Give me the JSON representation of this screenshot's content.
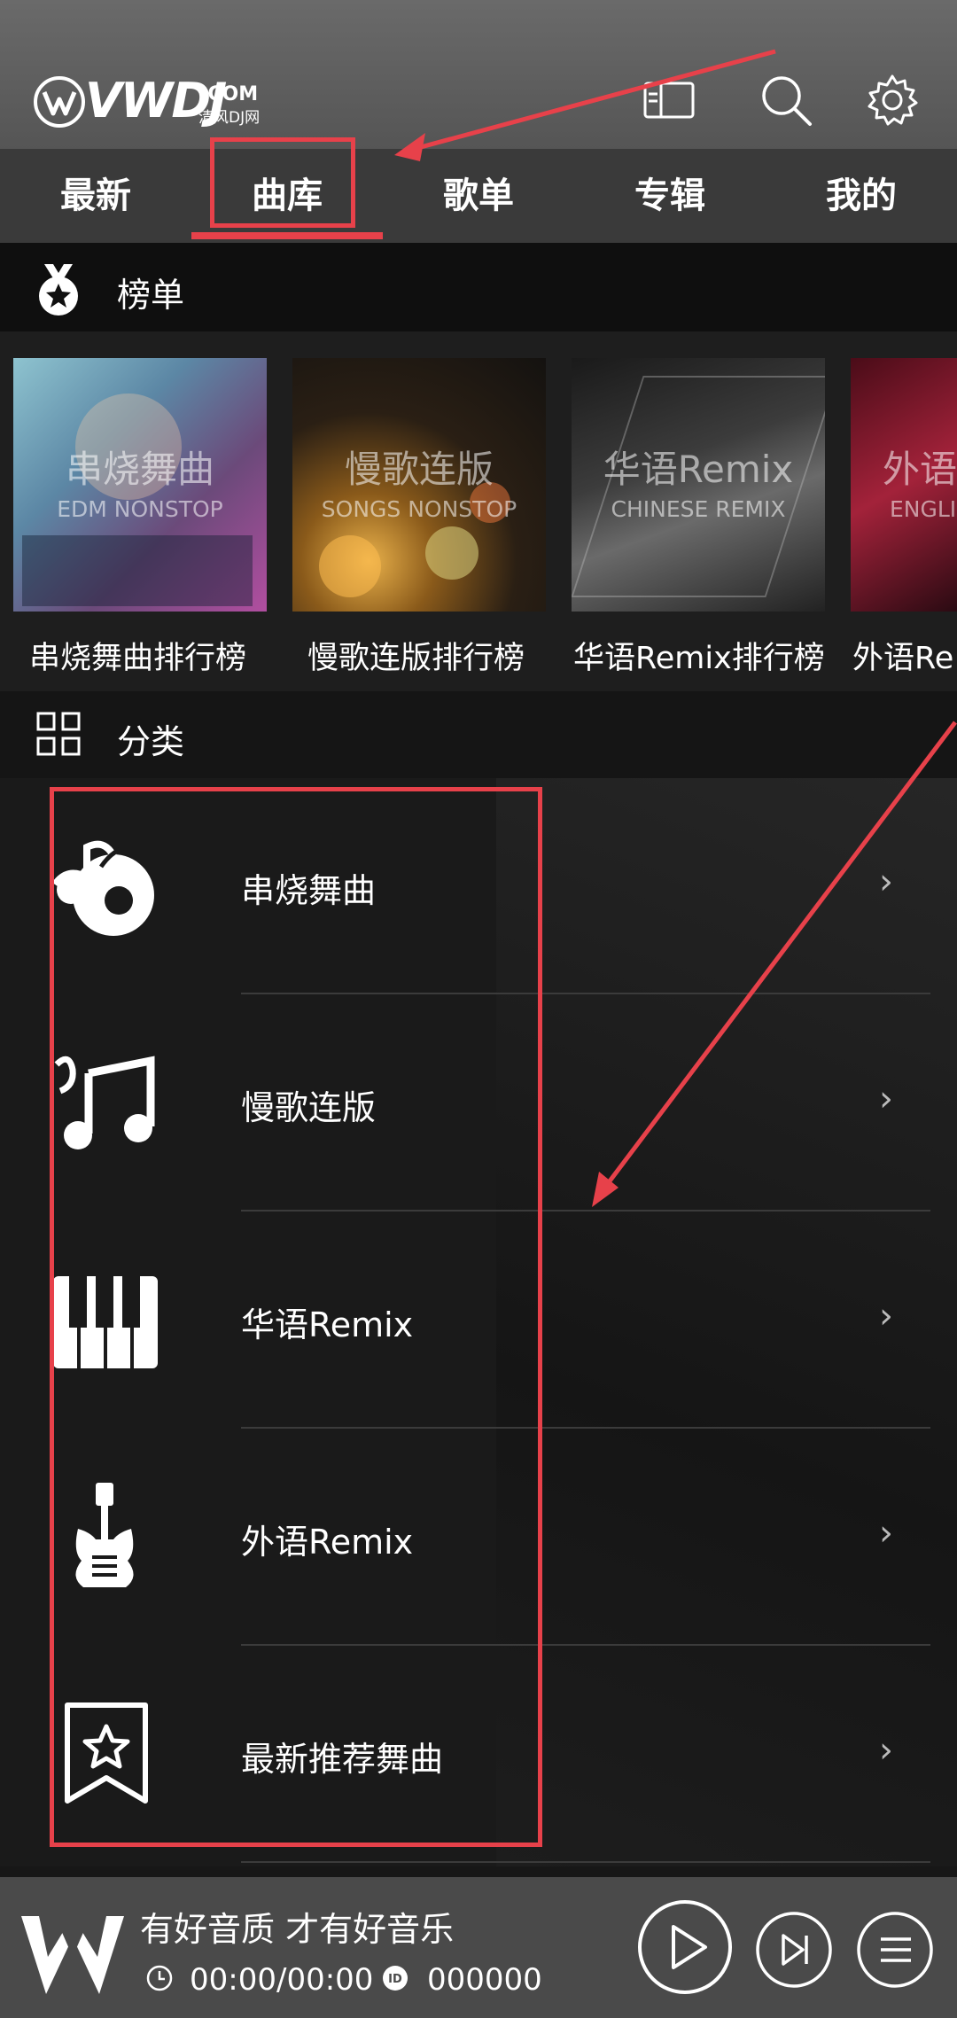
{
  "brand": {
    "logo_text": "VWDJ",
    "logo_com": ".COM",
    "logo_sub": "清风DJ网"
  },
  "header_icons": [
    "sidebar-toggle-icon",
    "search-icon",
    "gear-icon"
  ],
  "tabs": [
    {
      "label": "最新"
    },
    {
      "label": "曲库"
    },
    {
      "label": "歌单"
    },
    {
      "label": "专辑"
    },
    {
      "label": "我的"
    }
  ],
  "active_tab": "曲库",
  "rankings": {
    "section_title": "榜单",
    "section_icon": "medal-icon",
    "items": [
      {
        "title": "串烧舞曲",
        "subtitle": "EDM NONSTOP",
        "label": "串烧舞曲排行榜"
      },
      {
        "title": "慢歌连版",
        "subtitle": "SONGS NONSTOP",
        "label": "慢歌连版排行榜"
      },
      {
        "title": "华语Remix",
        "subtitle": "CHINESE REMIX",
        "label": "华语Remix排行榜"
      },
      {
        "title": "外语",
        "subtitle": "ENGLI",
        "label": "外语Re"
      }
    ]
  },
  "categories": {
    "section_title": "分类",
    "section_icon": "grid-icon",
    "items": [
      {
        "label": "串烧舞曲",
        "icon": "music-disc-icon"
      },
      {
        "label": "慢歌连版",
        "icon": "music-notes-icon"
      },
      {
        "label": "华语Remix",
        "icon": "piano-keys-icon"
      },
      {
        "label": "外语Remix",
        "icon": "guitar-icon"
      },
      {
        "label": "最新推荐舞曲",
        "icon": "star-bookmark-icon"
      }
    ],
    "chevron": "›"
  },
  "player": {
    "title": "有好音质 才有好音乐",
    "time": "00:00/00:00",
    "id": "000000",
    "icons": [
      "clock-icon",
      "id-icon",
      "play-icon",
      "next-icon",
      "playlist-icon"
    ]
  },
  "colors": {
    "accent": "#e7414a",
    "header_bg": "#5e5e5e",
    "tab_bar_bg": "#3a3a3a",
    "content_bg": "#1a1a1a",
    "player_bg": "#4a4a4a"
  }
}
